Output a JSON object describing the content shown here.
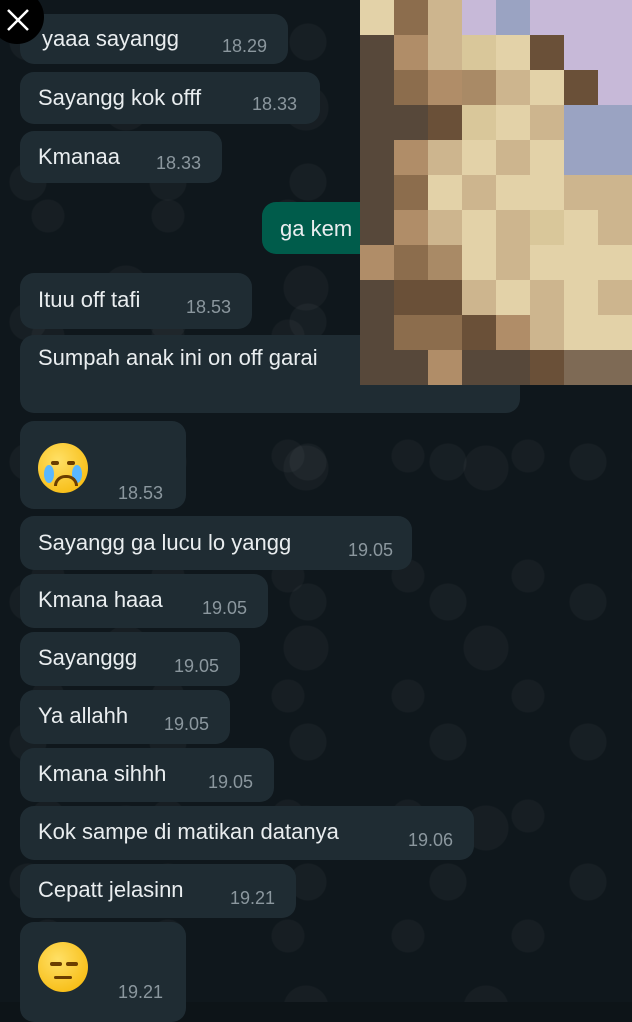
{
  "close_label": "close",
  "colors": {
    "incoming": "#1f2c33",
    "outgoing": "#005c4b",
    "background": "#0f171c",
    "time": "#8b979e"
  },
  "messages": [
    {
      "text": "yaaa sayangg",
      "time": "18.29",
      "direction": "in"
    },
    {
      "text": "Sayangg kok offf",
      "time": "18.33",
      "direction": "in"
    },
    {
      "text": "Kmanaa",
      "time": "18.33",
      "direction": "in"
    },
    {
      "text": "ga kem",
      "time": "",
      "direction": "out"
    },
    {
      "text": "Ituu off tafi",
      "time": "18.53",
      "direction": "in"
    },
    {
      "text": "Sumpah anak ini on off garai",
      "time": "",
      "direction": "in"
    },
    {
      "text": "crying-face-emoji",
      "time": "18.53",
      "direction": "in"
    },
    {
      "text": "Sayangg ga lucu lo yangg",
      "time": "19.05",
      "direction": "in"
    },
    {
      "text": "Kmana haaa",
      "time": "19.05",
      "direction": "in"
    },
    {
      "text": "Sayanggg",
      "time": "19.05",
      "direction": "in"
    },
    {
      "text": "Ya allahh",
      "time": "19.05",
      "direction": "in"
    },
    {
      "text": "Kmana sihhh",
      "time": "19.05",
      "direction": "in"
    },
    {
      "text": "Kok sampe di matikan datanya",
      "time": "19.06",
      "direction": "in"
    },
    {
      "text": "Cepatt jelasinn",
      "time": "19.21",
      "direction": "in"
    },
    {
      "text": "unamused-face-emoji",
      "time": "19.21",
      "direction": "in"
    }
  ]
}
